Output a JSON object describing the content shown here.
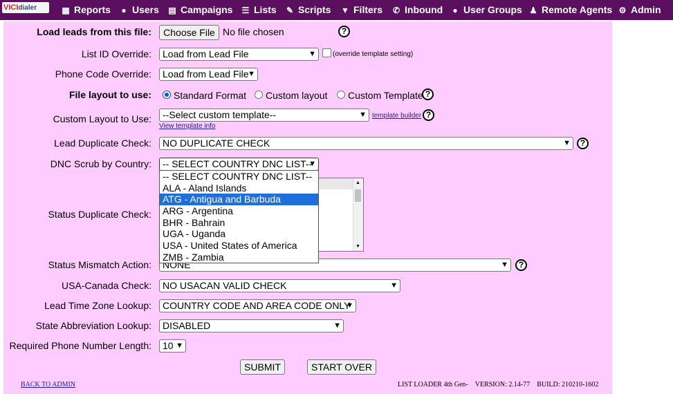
{
  "nav": {
    "logo_v": "VICI",
    "logo_rest": "dialer",
    "items": [
      {
        "label": "Reports",
        "icon": "reports-icon"
      },
      {
        "label": "Users",
        "icon": "users-icon"
      },
      {
        "label": "Campaigns",
        "icon": "campaigns-icon"
      },
      {
        "label": "Lists",
        "icon": "lists-icon"
      },
      {
        "label": "Scripts",
        "icon": "scripts-icon"
      },
      {
        "label": "Filters",
        "icon": "filter-icon"
      },
      {
        "label": "Inbound",
        "icon": "inbound-icon"
      },
      {
        "label": "User Groups",
        "icon": "user-groups-icon"
      },
      {
        "label": "Remote Agents",
        "icon": "remote-agents-icon"
      },
      {
        "label": "Admin",
        "icon": "gear-icon"
      }
    ]
  },
  "form": {
    "load_file": {
      "label": "Load leads from this file:",
      "button": "Choose File",
      "status": "No file chosen"
    },
    "list_id": {
      "label": "List ID Override:",
      "value": "Load from Lead File",
      "checkbox_label": "(override template setting)"
    },
    "phone_code": {
      "label": "Phone Code Override:",
      "value": "Load from Lead File"
    },
    "file_layout": {
      "label": "File layout to use:",
      "options": [
        "Standard Format",
        "Custom layout",
        "Custom Template"
      ],
      "selected": "Standard Format"
    },
    "custom_layout": {
      "label": "Custom Layout to Use:",
      "value": "--Select custom template--",
      "builder_link": "template builder",
      "info_link": "View template info"
    },
    "dup_check": {
      "label": "Lead Duplicate Check:",
      "value": "NO DUPLICATE CHECK"
    },
    "dnc_scrub": {
      "label": "DNC Scrub by Country:",
      "value": "-- SELECT COUNTRY DNC LIST--",
      "options": [
        "-- SELECT COUNTRY DNC LIST--",
        "ALA - Aland Islands",
        "ATG - Antigua and Barbuda",
        "ARG - Argentina",
        "BHR - Bahrain",
        "UGA - Uganda",
        "USA - United States of America",
        "ZMB - Zambia"
      ],
      "highlighted": "ATG - Antigua and Barbuda"
    },
    "status_dup": {
      "label": "Status Duplicate Check:"
    },
    "status_mismatch": {
      "label": "Status Mismatch Action:",
      "value": "NONE"
    },
    "usacan": {
      "label": "USA-Canada Check:",
      "value": "NO USACAN VALID CHECK"
    },
    "tz_lookup": {
      "label": "Lead Time Zone Lookup:",
      "value": "COUNTRY CODE AND AREA CODE ONLY"
    },
    "state_abbr": {
      "label": "State Abbreviation Lookup:",
      "value": "DISABLED"
    },
    "phone_len": {
      "label": "Required Phone Number Length:",
      "value": "10"
    },
    "submit": "SUBMIT",
    "start_over": "START OVER"
  },
  "footer": {
    "back": "BACK TO ADMIN",
    "loader": "LIST LOADER 4th Gen-",
    "version": "VERSION: 2.14-77",
    "build": "BUILD: 210210-1602"
  },
  "help_glyph": "?"
}
